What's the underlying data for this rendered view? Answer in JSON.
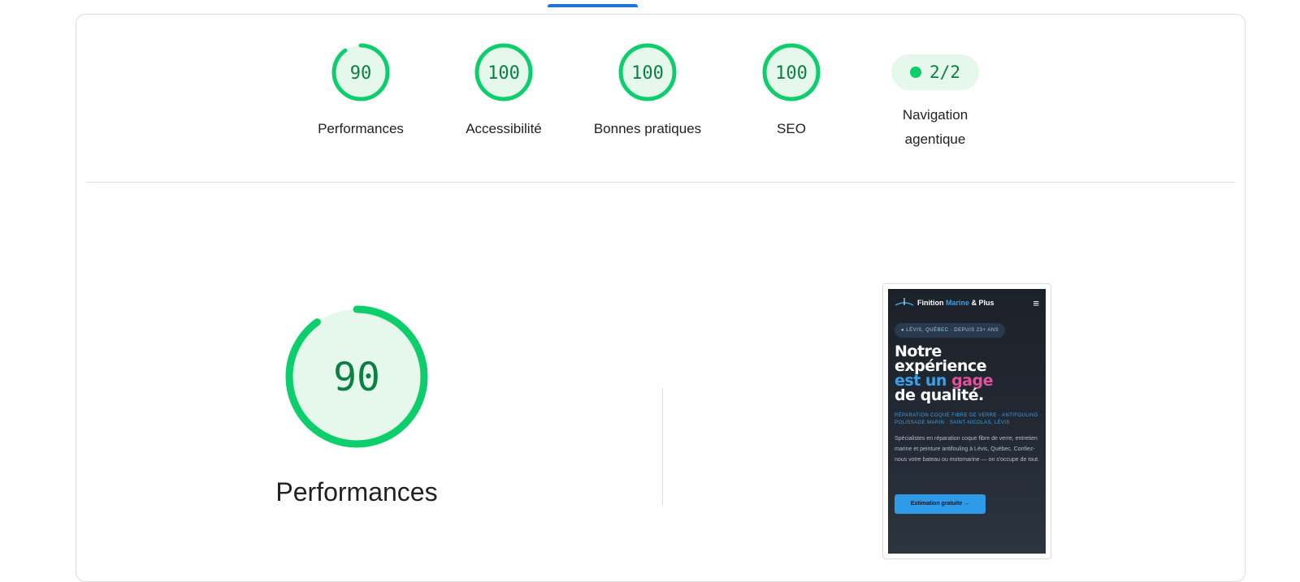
{
  "gauges": [
    {
      "label": "Performances",
      "value": "90",
      "score": 0.9
    },
    {
      "label": "Accessibilité",
      "value": "100",
      "score": 1.0
    },
    {
      "label": "Bonnes pratiques",
      "value": "100",
      "score": 1.0
    },
    {
      "label": "SEO",
      "value": "100",
      "score": 1.0
    }
  ],
  "navigation": {
    "label": "Navigation agentique",
    "value": "2/2"
  },
  "main": {
    "title": "Performances",
    "value": "90",
    "score": 0.9
  },
  "colors": {
    "pass": "#0cce6b",
    "pass_bg": "#e6f7ec",
    "pass_text": "#0b8043",
    "accent": "#1a73e8"
  },
  "screenshot": {
    "brand_start": "Finition ",
    "brand_accent": "Marine",
    "brand_end": " & Plus",
    "menu_icon": "hamburger-icon",
    "pill": "● LÉVIS, QUÉBEC · DEPUIS 23+ ANS",
    "hero_line1": "Notre",
    "hero_line2": "expérience",
    "hero_line3a": "est un ",
    "hero_line3b": "gage",
    "hero_line4": "de qualité.",
    "sub": "RÉPARATION COQUE FIBRE DE VERRE · ANTIFOULING · POLISSAGE MARIN · SAINT-NICOLAS, LÉVIS",
    "desc": "Spécialistes en réparation coque fibre de verre, entretien marine et peinture antifouling à Lévis, Québec. Confiez-nous votre bateau ou motomarine — on s'occupe de tout.",
    "cta": "Estimation gratuite →"
  }
}
